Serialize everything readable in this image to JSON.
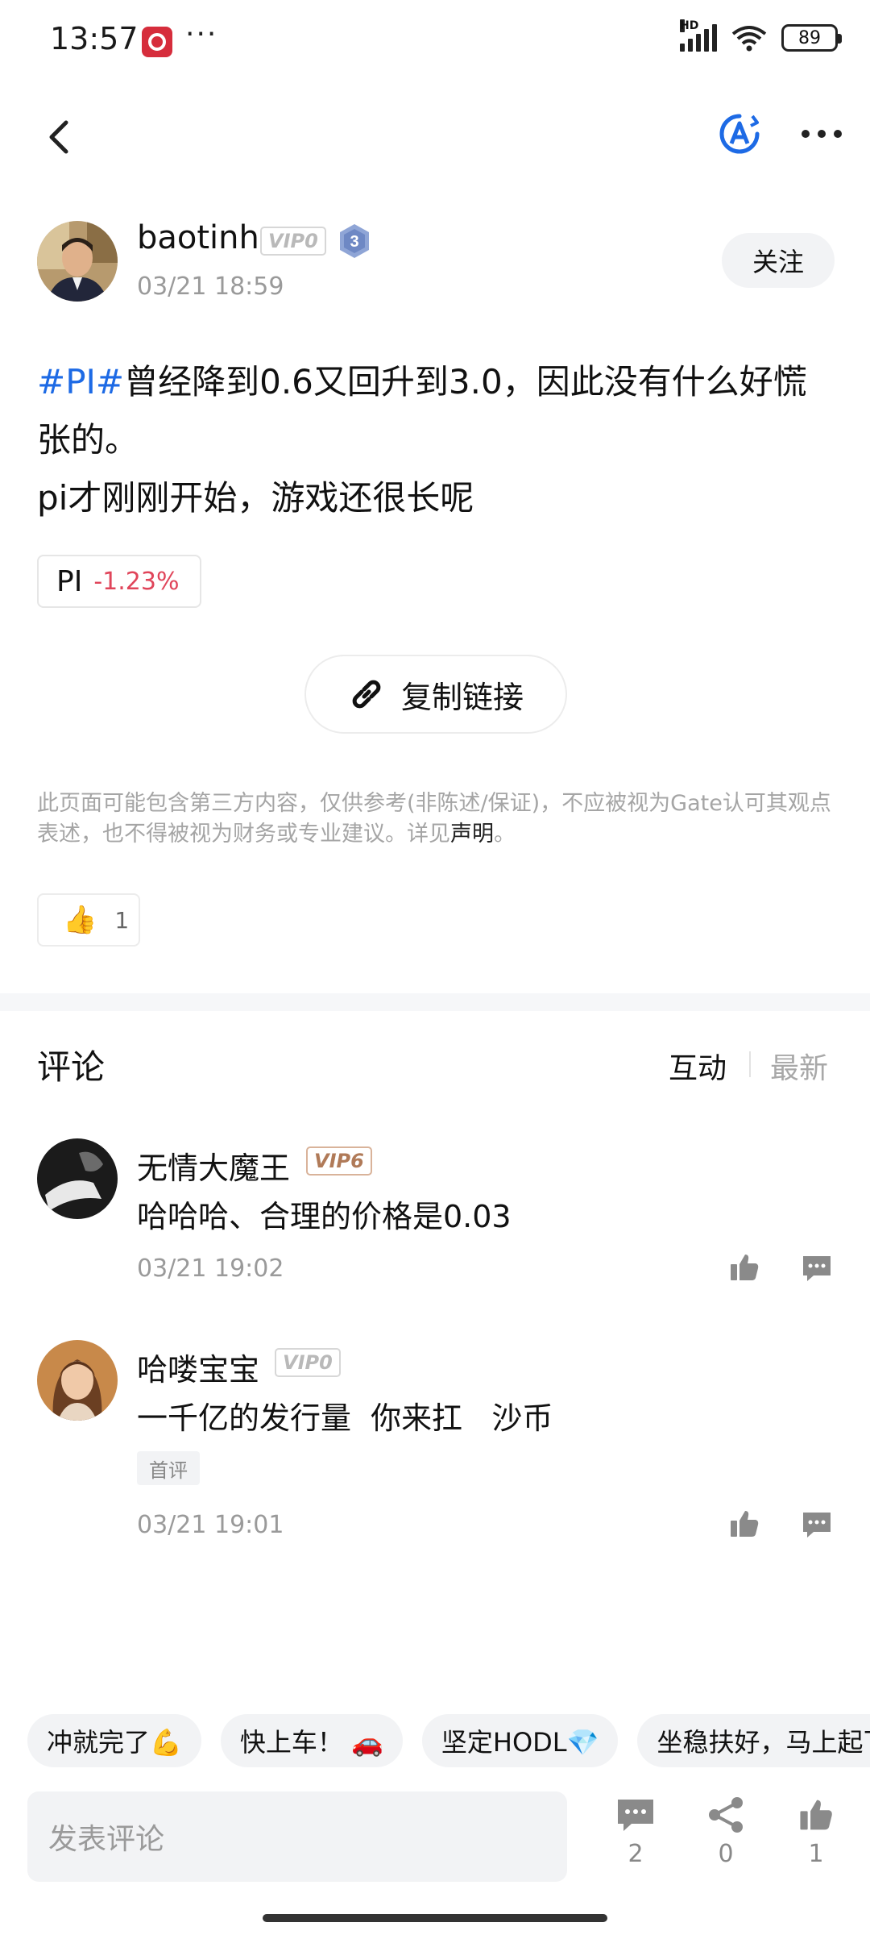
{
  "status_bar": {
    "time": "13:57",
    "dots": "···",
    "network": "HD",
    "battery": "89"
  },
  "post": {
    "author": "baotinh",
    "vip": "VIP0",
    "level": "3",
    "time": "03/21 18:59",
    "follow_label": "关注",
    "hashtag": "#PI#",
    "text_line1": "曾经降到0.6又回升到3.0，因此没有什么好慌张的。",
    "text_line2": "pi才刚刚开始，游戏还很长呢",
    "ticker": {
      "name": "PI",
      "change": "-1.23%"
    },
    "copy_link_label": "复制链接",
    "disclaimer": "此页面可能包含第三方内容，仅供参考(非陈述/保证)，不应被视为Gate认可其观点表述，也不得被视为财务或专业建议。详见",
    "disclaimer_link": "声明",
    "disclaimer_end": "。",
    "likes": "1"
  },
  "comments_section": {
    "title": "评论",
    "sort_hot": "互动",
    "sort_new": "最新",
    "items": [
      {
        "name": "无情大魔王",
        "vip": "VIP6",
        "text": "哈哈哈、合理的价格是0.03",
        "time": "03/21 19:02"
      },
      {
        "name": "哈喽宝宝",
        "vip": "VIP0",
        "text": "一千亿的发行量  你来扛   沙币",
        "tag": "首评",
        "time": "03/21 19:01"
      }
    ]
  },
  "quick_replies": [
    "冲就完了💪",
    "快上车！ 🚗",
    "坚定HODL💎",
    "坐稳扶好，马上起飞"
  ],
  "bottom_bar": {
    "input_placeholder": "发表评论",
    "comment_count": "2",
    "share_count": "0",
    "like_count": "1"
  },
  "colors": {
    "hashtag": "#1d6ae5",
    "negative_change": "#e0455a",
    "translate_icon": "#1d6ae5"
  }
}
